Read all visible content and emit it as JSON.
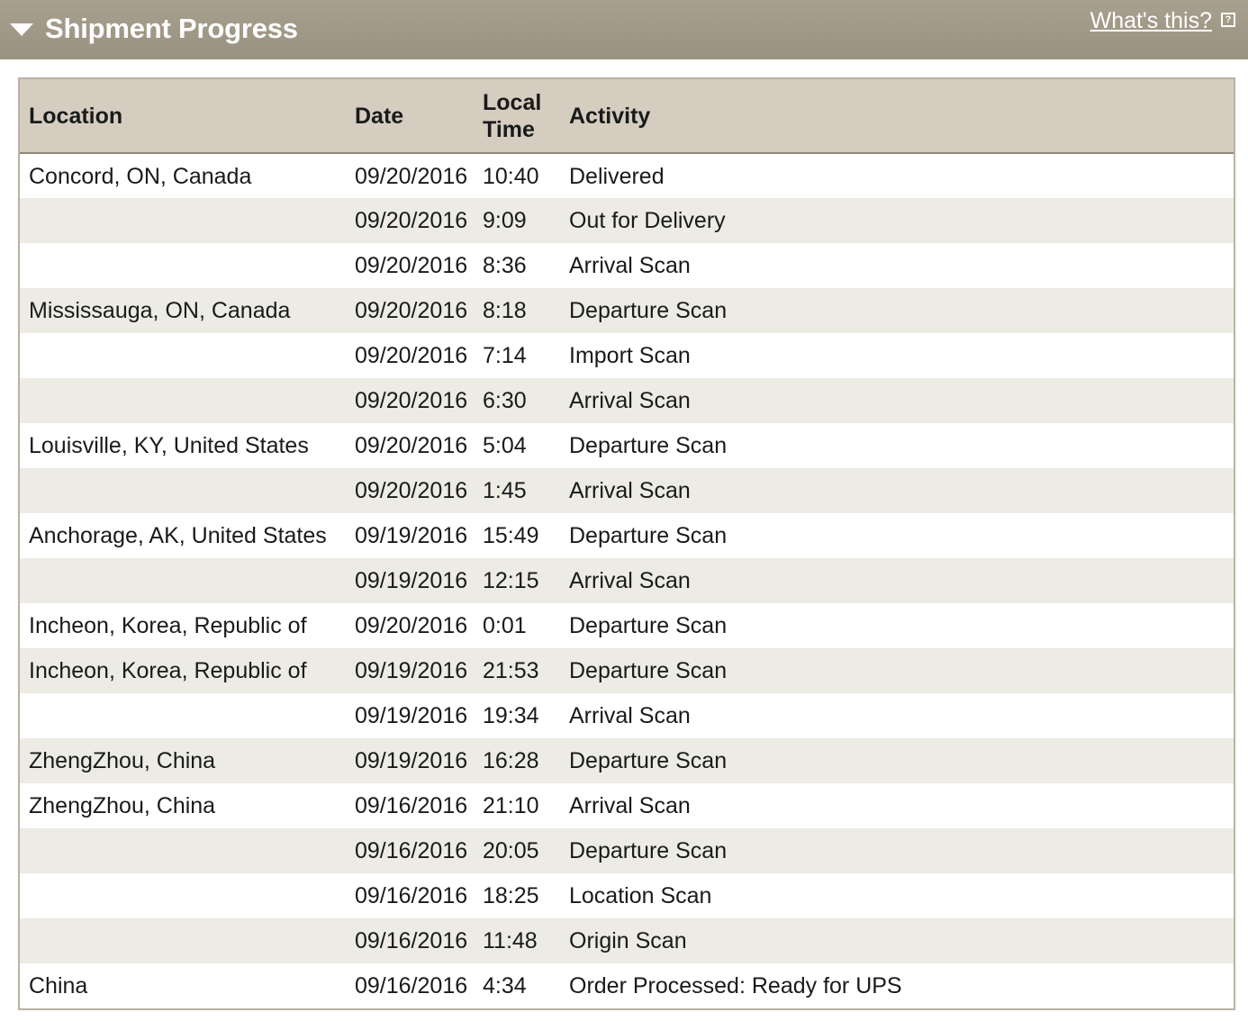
{
  "header": {
    "title": "Shipment Progress",
    "help_link": "What's this?",
    "help_icon": "?"
  },
  "table": {
    "columns": [
      "Location",
      "Date",
      "Local Time",
      "Activity"
    ],
    "rows": [
      {
        "location": "Concord, ON, Canada",
        "date": "09/20/2016",
        "time": "10:40",
        "activity": "Delivered"
      },
      {
        "location": "",
        "date": "09/20/2016",
        "time": "9:09",
        "activity": "Out for Delivery"
      },
      {
        "location": "",
        "date": "09/20/2016",
        "time": "8:36",
        "activity": "Arrival Scan"
      },
      {
        "location": "Mississauga, ON, Canada",
        "date": "09/20/2016",
        "time": "8:18",
        "activity": "Departure Scan"
      },
      {
        "location": "",
        "date": "09/20/2016",
        "time": "7:14",
        "activity": "Import Scan"
      },
      {
        "location": "",
        "date": "09/20/2016",
        "time": "6:30",
        "activity": "Arrival Scan"
      },
      {
        "location": "Louisville, KY, United States",
        "date": "09/20/2016",
        "time": "5:04",
        "activity": "Departure Scan"
      },
      {
        "location": "",
        "date": "09/20/2016",
        "time": "1:45",
        "activity": "Arrival Scan"
      },
      {
        "location": "Anchorage, AK, United States",
        "date": "09/19/2016",
        "time": "15:49",
        "activity": "Departure Scan"
      },
      {
        "location": "",
        "date": "09/19/2016",
        "time": "12:15",
        "activity": "Arrival Scan"
      },
      {
        "location": "Incheon, Korea, Republic of",
        "date": "09/20/2016",
        "time": "0:01",
        "activity": "Departure Scan"
      },
      {
        "location": "Incheon, Korea, Republic of",
        "date": "09/19/2016",
        "time": "21:53",
        "activity": "Departure Scan"
      },
      {
        "location": "",
        "date": "09/19/2016",
        "time": "19:34",
        "activity": "Arrival Scan"
      },
      {
        "location": "ZhengZhou, China",
        "date": "09/19/2016",
        "time": "16:28",
        "activity": "Departure Scan"
      },
      {
        "location": "ZhengZhou, China",
        "date": "09/16/2016",
        "time": "21:10",
        "activity": "Arrival Scan"
      },
      {
        "location": "",
        "date": "09/16/2016",
        "time": "20:05",
        "activity": "Departure Scan"
      },
      {
        "location": "",
        "date": "09/16/2016",
        "time": "18:25",
        "activity": "Location Scan"
      },
      {
        "location": "",
        "date": "09/16/2016",
        "time": "11:48",
        "activity": "Origin Scan"
      },
      {
        "location": "China",
        "date": "09/16/2016",
        "time": "4:34",
        "activity": "Order Processed: Ready for UPS"
      }
    ]
  }
}
